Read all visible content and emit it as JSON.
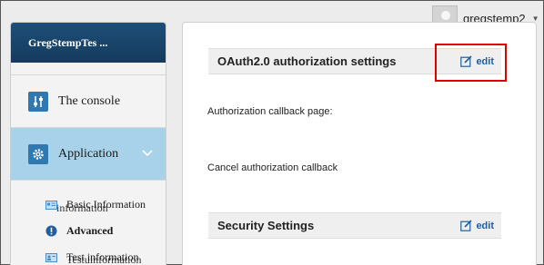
{
  "user": {
    "name": "gregstemp2"
  },
  "sidebar": {
    "app_name": "GregStempTes ...",
    "items": [
      {
        "label": "The console",
        "icon": "sliders-icon"
      },
      {
        "label": "Application",
        "icon": "gear-icon",
        "active": true
      }
    ],
    "sub_items": [
      {
        "label": "Basic Information",
        "overlay": "information",
        "icon": "id-card-icon"
      },
      {
        "label": "Advanced",
        "icon": "exclamation-icon"
      },
      {
        "label": "Test information",
        "overlay": "Testuinformation",
        "icon": "user-card-icon"
      }
    ]
  },
  "main": {
    "sections": [
      {
        "title": "OAuth2.0 authorization settings",
        "edit_label": "edit",
        "fields": [
          "Authorization callback page:",
          "Cancel authorization callback"
        ]
      },
      {
        "title": "Security Settings",
        "edit_label": "edit"
      }
    ]
  },
  "colors": {
    "header_bg": "#1d4e78",
    "active_nav": "#a8d1ea",
    "icon_blue": "#2f78b0",
    "link": "#1f5f9f",
    "highlight": "#e00000"
  }
}
